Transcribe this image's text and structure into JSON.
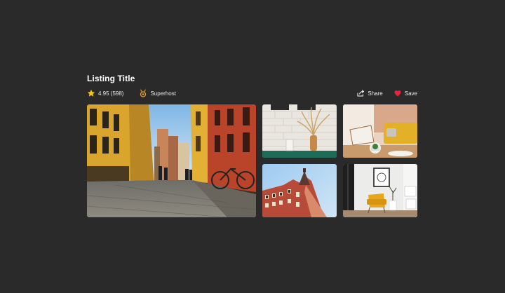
{
  "listing": {
    "title": "Listing Title"
  },
  "meta": {
    "rating": "4.95 (598)",
    "host_badge": "Superhost",
    "share_label": "Share",
    "save_label": "Save"
  },
  "colors": {
    "background": "#2a2a2a",
    "star": "#f5c518",
    "heart": "#e5243b",
    "badge": "#f0a020"
  },
  "icons": [
    "star-icon",
    "superhost-icon",
    "share-icon",
    "heart-icon"
  ],
  "gallery": [
    {
      "name": "photo-street",
      "alt": "Cobblestone street"
    },
    {
      "name": "photo-brick-wall"
    },
    {
      "name": "photo-living-room"
    },
    {
      "name": "photo-building"
    },
    {
      "name": "photo-yellow-chair"
    }
  ]
}
